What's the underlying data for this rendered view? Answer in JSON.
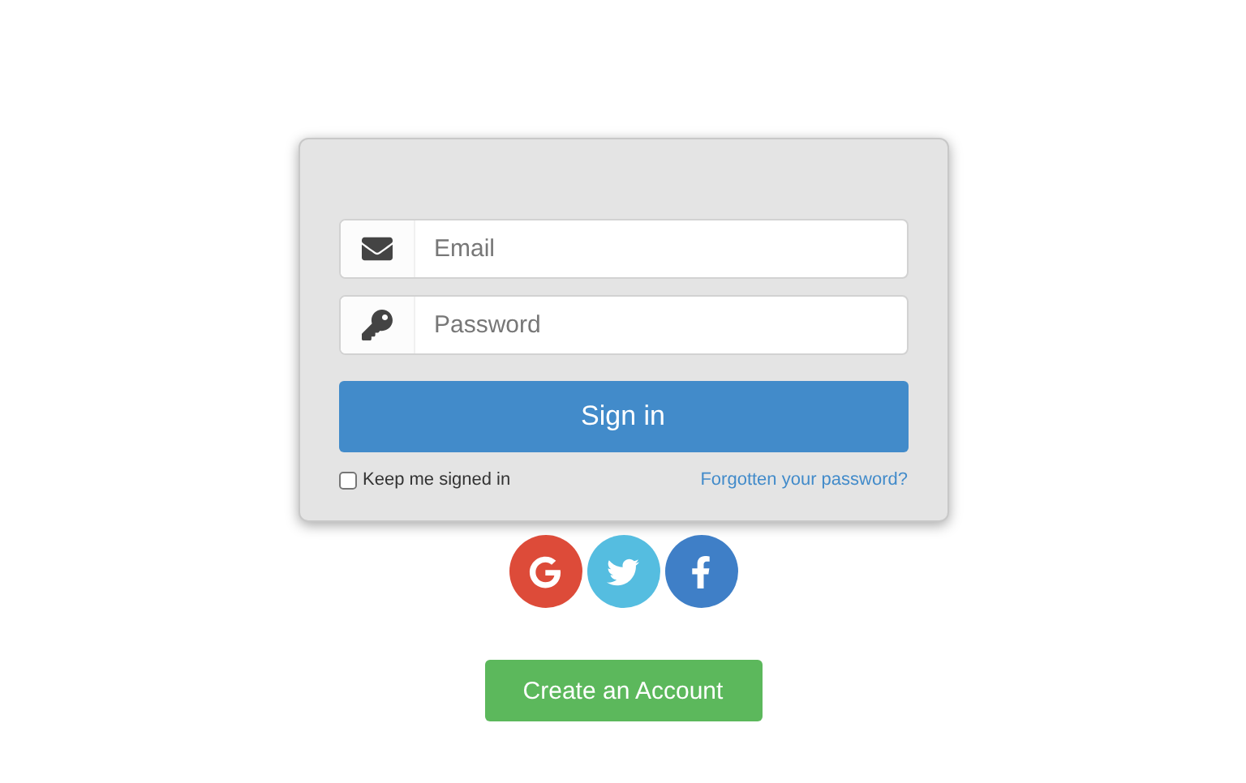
{
  "login": {
    "fields": [
      {
        "kind": "email",
        "placeholder": "Email"
      },
      {
        "kind": "password",
        "placeholder": "Password"
      }
    ],
    "submit": "Sign in",
    "remember": {
      "label": "Keep me signed in",
      "checked": false
    },
    "forgot": "Forgotten your password?"
  },
  "social": [
    {
      "kind": "google",
      "color": "#dd4b39"
    },
    {
      "kind": "twitter",
      "color": "#55bde0"
    },
    {
      "kind": "facebook",
      "color": "#3f7fc7"
    }
  ],
  "create": "Create an Account"
}
